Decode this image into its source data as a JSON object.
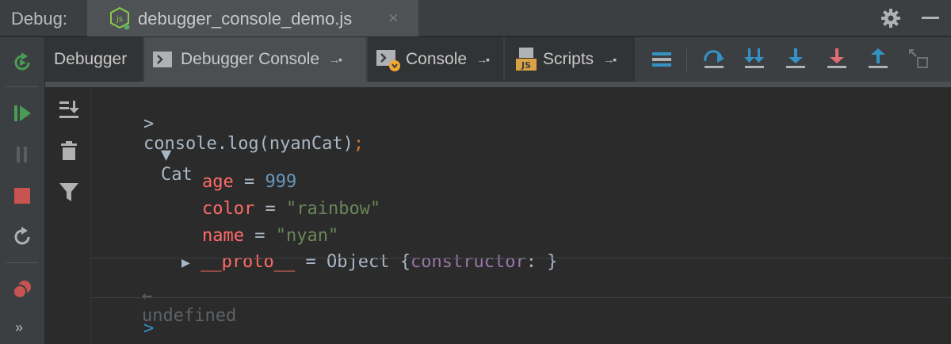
{
  "titlebar": {
    "debug_label": "Debug:",
    "tab_title": "debugger_console_demo.js",
    "close_glyph": "×",
    "icons": [
      "nodejs-icon",
      "gear-icon",
      "minimize-icon"
    ]
  },
  "tabs": [
    {
      "label": "Debugger",
      "selected": false
    },
    {
      "label": "Debugger Console",
      "selected": true,
      "pin": "→▪"
    },
    {
      "label": "Console",
      "selected": false,
      "pin": "→▪"
    },
    {
      "label": "Scripts",
      "selected": false,
      "pin": "→▪"
    }
  ],
  "left_toolbar": {
    "more": "»",
    "icons": [
      "rerun-icon",
      "resume-icon",
      "pause-icon",
      "stop-icon",
      "restart-icon",
      "breakpoints-icon"
    ]
  },
  "console_toolbar": [
    "scroll-to-end-icon",
    "trash-icon",
    "filter-icon"
  ],
  "console": {
    "prompt_chevron": ">",
    "command": {
      "fn": "console.log(nyanCat)",
      "semi": ";"
    },
    "object": {
      "arrow": "▼",
      "name": "Cat",
      "props": [
        {
          "key": "age",
          "eq": " = ",
          "value": "999",
          "type": "number"
        },
        {
          "key": "color",
          "eq": " = ",
          "value": "\"rainbow\"",
          "type": "string"
        },
        {
          "key": "name",
          "eq": " = ",
          "value": "\"nyan\"",
          "type": "string"
        }
      ],
      "proto": {
        "arrow": "▶",
        "key": "__proto__",
        "eq": " = ",
        "obj": "Object ",
        "open": "{",
        "ctor": "constructor",
        "colon": ": ",
        "close": "}"
      }
    },
    "result": {
      "arrow": "←",
      "text": "undefined"
    },
    "input_prompt": ">"
  },
  "colors": {
    "accent_blue": "#3592c4",
    "green": "#499c54",
    "red": "#c75450"
  }
}
